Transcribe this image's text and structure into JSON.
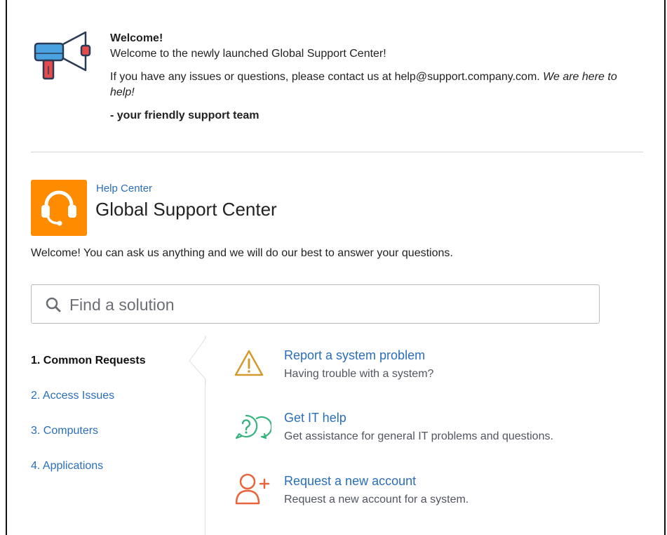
{
  "announcement": {
    "icon": "megaphone-icon",
    "title": "Welcome!",
    "line1": "Welcome to the newly launched Global Support Center!",
    "line2_plain": "If you have any issues or questions, please contact us at help@support.company.com. ",
    "line2_italic": "We are here to help!",
    "signoff": "- your friendly support team"
  },
  "help_center": {
    "breadcrumb": "Help Center",
    "title": "Global Support Center",
    "logo_icon": "headset-icon",
    "logo_color": "#ff8b00",
    "welcome": "Welcome! You can ask us anything and we will do our best to answer your questions."
  },
  "search": {
    "icon": "search-icon",
    "placeholder": "Find a solution",
    "value": ""
  },
  "nav": {
    "items": [
      {
        "label": "1. Common Requests",
        "active": true
      },
      {
        "label": "2. Access Issues",
        "active": false
      },
      {
        "label": "3. Computers",
        "active": false
      },
      {
        "label": "4. Applications",
        "active": false
      }
    ]
  },
  "requests": [
    {
      "icon": "warning-icon",
      "title": "Report a system problem",
      "description": "Having trouble with a system?"
    },
    {
      "icon": "help-chat-icon",
      "title": "Get IT help",
      "description": "Get assistance for general IT problems and questions."
    },
    {
      "icon": "add-user-icon",
      "title": "Request a new account",
      "description": "Request a new account for a system."
    }
  ],
  "colors": {
    "link": "#2a6ebb",
    "warning": "#d59a2c",
    "help": "#36b37e",
    "add_user": "#e8643c"
  }
}
